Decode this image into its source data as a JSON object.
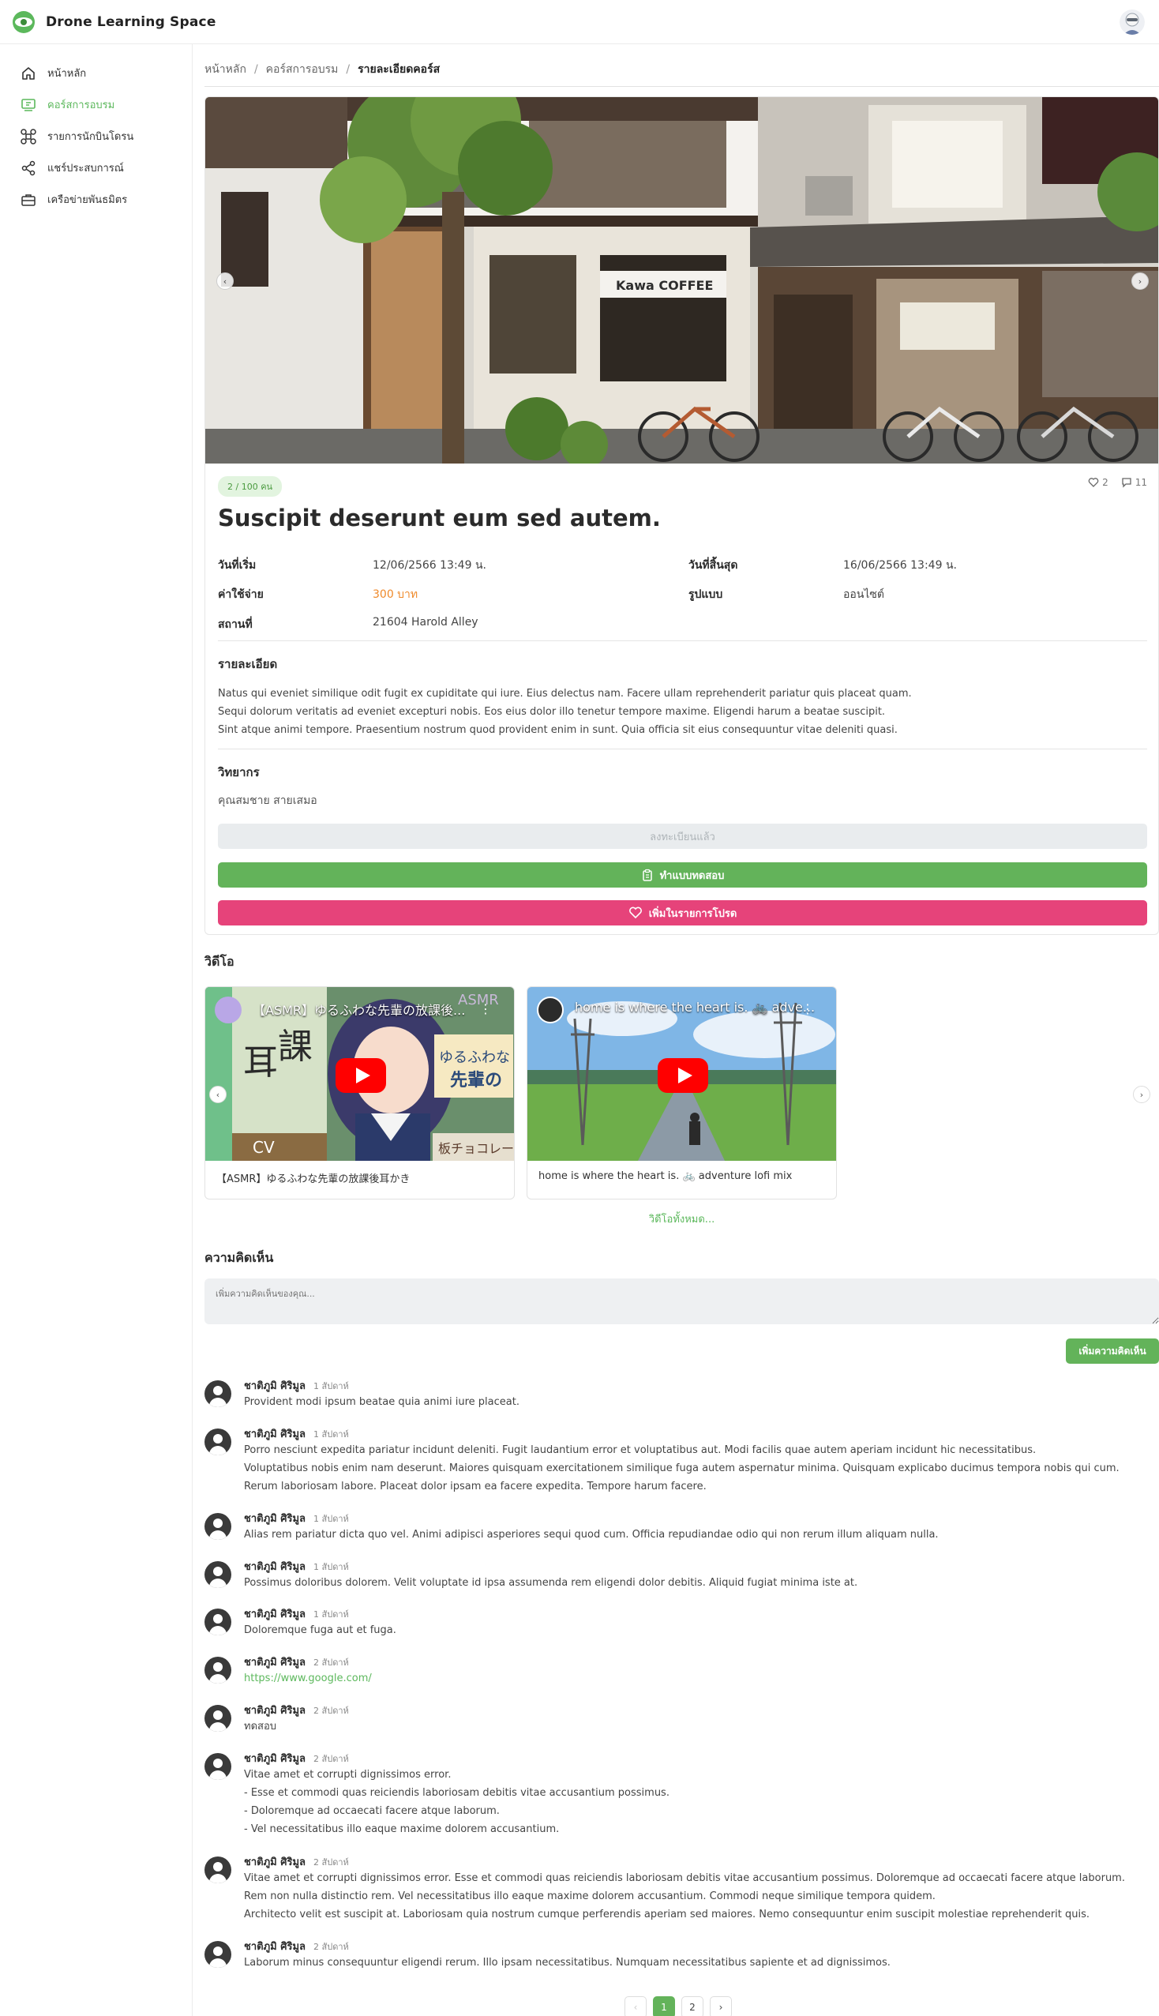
{
  "app": {
    "name": "Drone Learning Space"
  },
  "sidebar": {
    "items": [
      {
        "label": "หน้าหลัก",
        "icon": "home-icon"
      },
      {
        "label": "คอร์สการอบรม",
        "icon": "course-icon",
        "active": true
      },
      {
        "label": "รายการนักบินโดรน",
        "icon": "drone-icon"
      },
      {
        "label": "แชร์ประสบการณ์",
        "icon": "share-icon"
      },
      {
        "label": "เครือข่ายพันธมิตร",
        "icon": "briefcase-icon"
      }
    ]
  },
  "breadcrumb": {
    "home": "หน้าหลัก",
    "courses": "คอร์สการอบรม",
    "current": "รายละเอียดคอร์ส",
    "separator": "/"
  },
  "course": {
    "capacity_badge": "2 / 100 คน",
    "likes": "2",
    "comments_count": "11",
    "title": "Suscipit deserunt eum sed autem.",
    "start_label": "วันที่เริ่ม",
    "start_value": "12/06/2566 13:49 น.",
    "end_label": "วันที่สิ้นสุด",
    "end_value": "16/06/2566 13:49 น.",
    "cost_label": "ค่าใช้จ่าย",
    "cost_value": "300 บาท",
    "format_label": "รูปแบบ",
    "format_value": "ออนไซต์",
    "location_label": "สถานที่",
    "location_value": "21604 Harold Alley",
    "details_heading": "รายละเอียด",
    "details_lines": [
      "Natus qui eveniet similique odit fugit ex cupiditate qui iure. Eius delectus nam. Facere ullam reprehenderit pariatur quis placeat quam.",
      "Sequi dolorum veritatis ad eveniet excepturi nobis. Eos eius dolor illo tenetur tempore maxime. Eligendi harum a beatae suscipit.",
      "Sint atque animi tempore. Praesentium nostrum quod provident enim in sunt. Quia officia sit eius consequuntur vitae deleniti quasi."
    ],
    "speaker_heading": "วิทยากร",
    "speaker_name": "คุณสมชาย สายเสมอ",
    "registered_button": "ลงทะเบียนแล้ว",
    "quiz_button": "ทำแบบทดสอบ",
    "favorite_button": "เพิ่มในรายการโปรด"
  },
  "videos": {
    "heading": "วิดีโอ",
    "items": [
      {
        "overlay_title": "【ASMR】ゆるふわな先輩の放課後...",
        "caption": "【ASMR】ゆるふわな先輩の放課後耳かき"
      },
      {
        "overlay_title": "home is where the heart is. 🚲 adve...",
        "caption": "home is where the heart is. 🚲 adventure lofi mix"
      }
    ],
    "see_all": "วิดีโอทั้งหมด..."
  },
  "comments": {
    "heading": "ความคิดเห็น",
    "placeholder": "เพิ่มความคิดเห็นของคุณ...",
    "submit_label": "เพิ่มความคิดเห็น",
    "items": [
      {
        "author": "ชาติภูมิ ศิริมูล",
        "time": "1 สัปดาห์",
        "lines": [
          "Provident modi ipsum beatae quia animi iure placeat."
        ]
      },
      {
        "author": "ชาติภูมิ ศิริมูล",
        "time": "1 สัปดาห์",
        "lines": [
          "Porro nesciunt expedita pariatur incidunt deleniti. Fugit laudantium error et voluptatibus aut. Modi facilis quae autem aperiam incidunt hic necessitatibus.",
          "Voluptatibus nobis enim nam deserunt. Maiores quisquam exercitationem similique fuga autem aspernatur minima. Quisquam explicabo ducimus tempora nobis qui cum.",
          "Rerum laboriosam labore. Placeat dolor ipsam ea facere expedita. Tempore harum facere."
        ]
      },
      {
        "author": "ชาติภูมิ ศิริมูล",
        "time": "1 สัปดาห์",
        "lines": [
          "Alias rem pariatur dicta quo vel. Animi adipisci asperiores sequi quod cum. Officia repudiandae odio qui non rerum illum aliquam nulla."
        ]
      },
      {
        "author": "ชาติภูมิ ศิริมูล",
        "time": "1 สัปดาห์",
        "lines": [
          "Possimus doloribus dolorem. Velit voluptate id ipsa assumenda rem eligendi dolor debitis. Aliquid fugiat minima iste at."
        ]
      },
      {
        "author": "ชาติภูมิ ศิริมูล",
        "time": "1 สัปดาห์",
        "lines": [
          "Doloremque fuga aut et fuga."
        ]
      },
      {
        "author": "ชาติภูมิ ศิริมูล",
        "time": "2 สัปดาห์",
        "lines": [
          "https://www.google.com/"
        ],
        "link": true
      },
      {
        "author": "ชาติภูมิ ศิริมูล",
        "time": "2 สัปดาห์",
        "lines": [
          "ทดสอบ"
        ]
      },
      {
        "author": "ชาติภูมิ ศิริมูล",
        "time": "2 สัปดาห์",
        "lines": [
          "Vitae amet et corrupti dignissimos error.",
          "- Esse et commodi quas reiciendis laboriosam debitis vitae accusantium possimus.",
          "- Doloremque ad occaecati facere atque laborum.",
          "- Vel necessitatibus illo eaque maxime dolorem accusantium."
        ]
      },
      {
        "author": "ชาติภูมิ ศิริมูล",
        "time": "2 สัปดาห์",
        "lines": [
          "Vitae amet et corrupti dignissimos error. Esse et commodi quas reiciendis laboriosam debitis vitae accusantium possimus. Doloremque ad occaecati facere atque laborum.",
          "Rem non nulla distinctio rem. Vel necessitatibus illo eaque maxime dolorem accusantium. Commodi neque similique tempora quidem.",
          "Architecto velit est suscipit at. Laboriosam quia nostrum cumque perferendis aperiam sed maiores. Nemo consequuntur enim suscipit molestiae reprehenderit quis."
        ]
      },
      {
        "author": "ชาติภูมิ ศิริมูล",
        "time": "2 สัปดาห์",
        "lines": [
          "Laborum minus consequuntur eligendi rerum. Illo ipsam necessitatibus. Numquam necessitatibus sapiente et ad dignissimos."
        ]
      }
    ]
  },
  "pagination": {
    "prev": "‹",
    "pages": [
      "1",
      "2"
    ],
    "current": "1",
    "next": "›"
  },
  "colors": {
    "accent": "#63b35a",
    "favorite": "#e6437a",
    "price": "#ef8a2b"
  }
}
